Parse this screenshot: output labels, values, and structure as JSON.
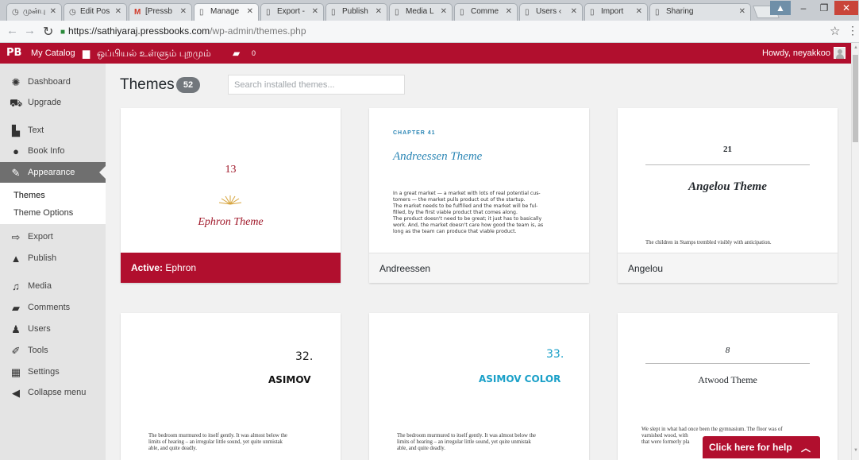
{
  "browser": {
    "tabs": [
      {
        "label": "முன்பு",
        "icon": "clock-icon",
        "active": false
      },
      {
        "label": "Edit Pos",
        "icon": "clock-icon",
        "active": false
      },
      {
        "label": "[Pressb",
        "icon": "gmail-icon",
        "active": false
      },
      {
        "label": "Manage",
        "icon": "page-icon",
        "active": true
      },
      {
        "label": "Export -",
        "icon": "page-icon",
        "active": false
      },
      {
        "label": "Publish",
        "icon": "page-icon",
        "active": false
      },
      {
        "label": "Media L",
        "icon": "page-icon",
        "active": false
      },
      {
        "label": "Comme",
        "icon": "page-icon",
        "active": false
      },
      {
        "label": "Users ‹",
        "icon": "page-icon",
        "active": false
      },
      {
        "label": "Import",
        "icon": "page-icon",
        "active": false
      },
      {
        "label": "Sharing",
        "icon": "page-icon",
        "active": false
      }
    ],
    "url_host": "https://sathiyaraj.pressbooks.com",
    "url_path": "/wp-admin/themes.php"
  },
  "adminbar": {
    "logo": "PB",
    "catalog": "My Catalog",
    "book_title": "ஒப்பியல் உள்ளும் புறமும்",
    "comment_count": "0",
    "howdy": "Howdy, neyakkoo"
  },
  "sidebar": {
    "items": [
      {
        "label": "Dashboard",
        "icon": "dashboard-icon"
      },
      {
        "label": "Upgrade",
        "icon": "cart-icon"
      },
      {
        "label": "Text",
        "icon": "book-icon"
      },
      {
        "label": "Book Info",
        "icon": "info-icon"
      },
      {
        "label": "Appearance",
        "icon": "brush-icon"
      },
      {
        "label": "Export",
        "icon": "export-icon"
      },
      {
        "label": "Publish",
        "icon": "store-icon"
      },
      {
        "label": "Media",
        "icon": "media-icon"
      },
      {
        "label": "Comments",
        "icon": "comment-icon"
      },
      {
        "label": "Users",
        "icon": "users-icon"
      },
      {
        "label": "Tools",
        "icon": "wrench-icon"
      },
      {
        "label": "Settings",
        "icon": "settings-icon"
      },
      {
        "label": "Collapse menu",
        "icon": "collapse-icon"
      }
    ],
    "submenu": [
      "Themes",
      "Theme Options"
    ]
  },
  "main": {
    "title": "Themes",
    "count": "52",
    "search_placeholder": "Search installed themes...",
    "themes": [
      {
        "name": "Ephron",
        "active_label": "Active:",
        "preview": {
          "number": "13",
          "title": "Ephron Theme"
        }
      },
      {
        "name": "Andreessen",
        "preview": {
          "chapter": "CHAPTER 41",
          "title": "Andreessen Theme",
          "lines": [
            "In a great market — a market with lots of real potential cus-",
            "tomers — the market pulls product out of the startup.",
            "   The market needs to be fulfilled and the market will be ful-",
            "filled, by the first viable product that comes along.",
            "The product doesn't need to be great; it just has to basically",
            "work. And, the market doesn't care how good the team is, as",
            "long as the team can produce that viable product."
          ]
        }
      },
      {
        "name": "Angelou",
        "preview": {
          "number": "21",
          "title": "Angelou Theme",
          "lines": [
            "The children in Stamps trembled visibly with anticipation."
          ]
        }
      },
      {
        "name": "Asimov",
        "preview": {
          "number": "32.",
          "title": "ASIMOV",
          "lines": [
            "The bedroom murmured to itself gently. It was almost below the",
            "limits of hearing – an irregular little sound, yet quite unmistak",
            "able, and quite deadly."
          ]
        }
      },
      {
        "name": "Asimov Color",
        "preview": {
          "number": "33.",
          "title": "ASIMOV COLOR",
          "lines": [
            "The bedroom murmured to itself gently. It was almost below the",
            "limits of hearing – an irregular little sound, yet quite unmistak",
            "able, and quite deadly."
          ]
        }
      },
      {
        "name": "Atwood",
        "preview": {
          "number": "8",
          "title": "Atwood Theme",
          "lines": [
            "We slept in what had once been the gymnasium. The floor was of",
            "varnished wood, with",
            "that were formerly pla"
          ]
        }
      }
    ]
  },
  "help": {
    "label": "Click here for help"
  },
  "colors": {
    "brand_red": "#b10f2e",
    "sidebar_bg": "#e4e4e4",
    "asimov_color_accent": "#1aa0c8",
    "andreessen_accent": "#2b86b5"
  }
}
